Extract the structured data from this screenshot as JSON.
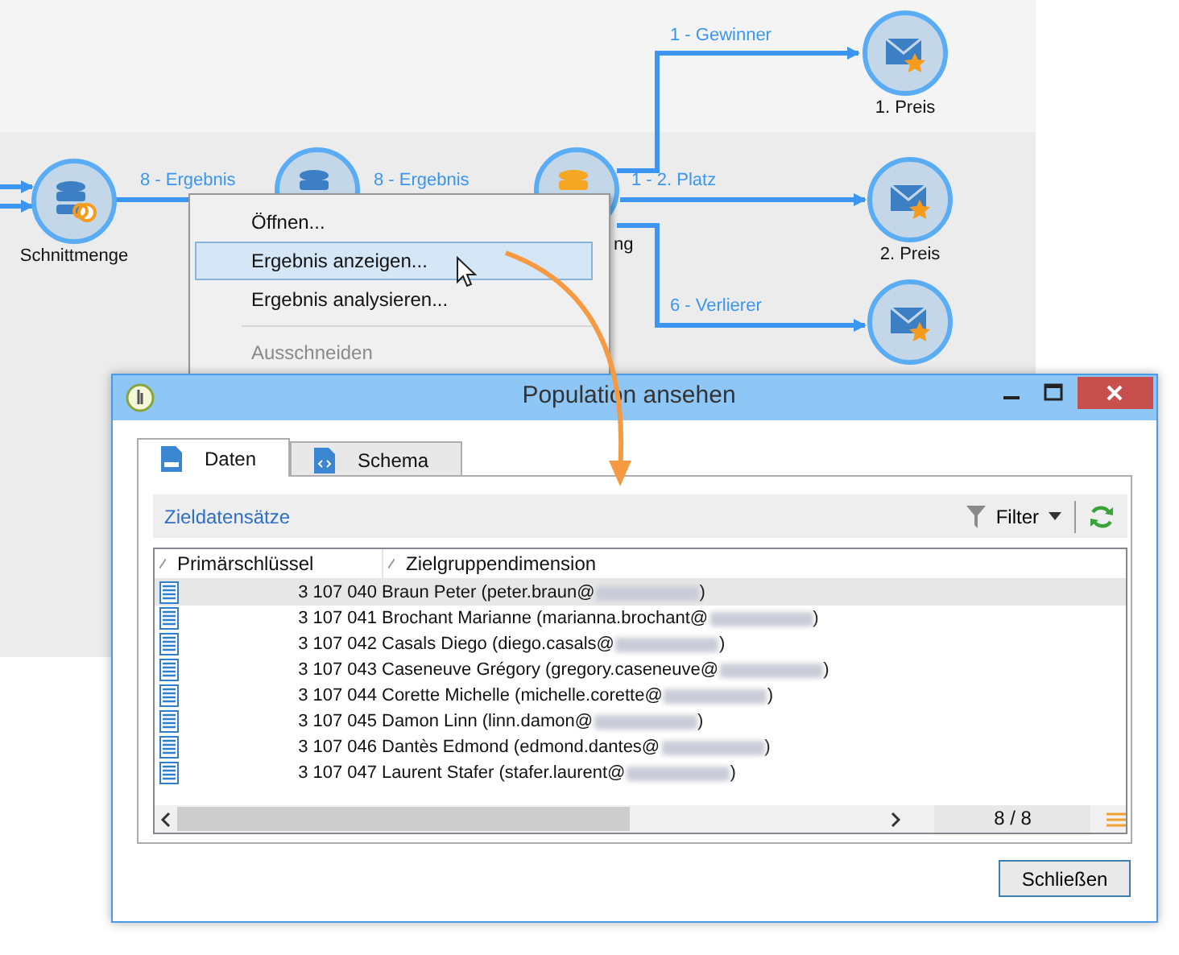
{
  "workflow": {
    "nodes": [
      {
        "kind": "intersection",
        "label": "Schnittmenge"
      },
      {
        "kind": "database"
      },
      {
        "kind": "split",
        "label": "ng"
      },
      {
        "kind": "delivery",
        "label": "1. Preis"
      },
      {
        "kind": "delivery",
        "label": "2. Preis"
      },
      {
        "kind": "delivery"
      }
    ],
    "transitions": [
      "8 - Ergebnis",
      "8 - Ergebnis",
      "1 - Gewinner",
      "1 - 2. Platz",
      "6 - Verlierer"
    ]
  },
  "context_menu": {
    "items": [
      {
        "kind": "item",
        "label": "Öffnen...",
        "selected": false,
        "disabled": false
      },
      {
        "kind": "item",
        "label": "Ergebnis anzeigen...",
        "selected": true,
        "disabled": false
      },
      {
        "kind": "item",
        "label": "Ergebnis analysieren...",
        "selected": false,
        "disabled": false
      },
      {
        "kind": "separator"
      },
      {
        "kind": "item",
        "label": "Ausschneiden",
        "selected": false,
        "disabled": true
      }
    ]
  },
  "dialog": {
    "title": "Population ansehen",
    "tabs": [
      {
        "label": "Daten",
        "kind": "sql",
        "selected": true
      },
      {
        "label": "Schema",
        "kind": "schema",
        "selected": false
      }
    ],
    "toolbar": {
      "title": "Zieldatensätze",
      "filter": "Filter"
    },
    "table": {
      "columns": [
        "Primärschlüssel",
        "Zielgruppendimension"
      ],
      "rows": [
        {
          "key": "3 107 040",
          "name": "Braun Peter (peter.braun@",
          "suffix": ")",
          "selected": true
        },
        {
          "key": "3 107 041",
          "name": "Brochant Marianne (marianna.brochant@",
          "suffix": ")",
          "selected": false
        },
        {
          "key": "3 107 042",
          "name": "Casals Diego (diego.casals@",
          "suffix": ")",
          "selected": false
        },
        {
          "key": "3 107 043",
          "name": "Caseneuve Grégory (gregory.caseneuve@",
          "suffix": ")",
          "selected": false
        },
        {
          "key": "3 107 044",
          "name": "Corette Michelle (michelle.corette@",
          "suffix": ")",
          "selected": false
        },
        {
          "key": "3 107 045",
          "name": "Damon Linn (linn.damon@",
          "suffix": ")",
          "selected": false
        },
        {
          "key": "3 107 046",
          "name": "Dantès Edmond (edmond.dantes@",
          "suffix": ")",
          "selected": false
        },
        {
          "key": "3 107 047",
          "name": "Laurent Stafer (stafer.laurent@",
          "suffix": ")",
          "selected": false
        }
      ],
      "count": "8 / 8"
    },
    "button": "Schließen"
  }
}
